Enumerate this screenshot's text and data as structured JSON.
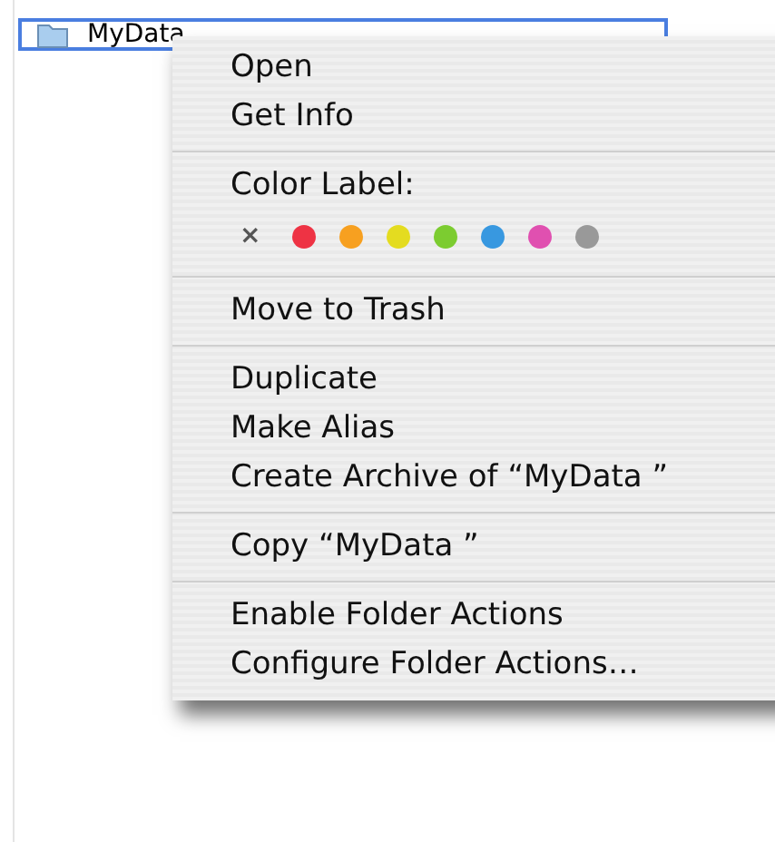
{
  "file_row": {
    "name": "MyData",
    "selected": true
  },
  "menu": [
    {
      "kind": "item",
      "label": "Open"
    },
    {
      "kind": "item",
      "label": "Get Info"
    },
    {
      "kind": "separator"
    },
    {
      "kind": "heading",
      "label": "Color Label:"
    },
    {
      "kind": "colors",
      "none": "×",
      "colors": [
        {
          "color": "#ee3344"
        },
        {
          "color": "#f7a020"
        },
        {
          "color": "#e4dc20"
        },
        {
          "color": "#7ccc30"
        },
        {
          "color": "#3898e0"
        },
        {
          "color": "#e050b0"
        },
        {
          "color": "#999999"
        }
      ]
    },
    {
      "kind": "separator"
    },
    {
      "kind": "item",
      "label": "Move to Trash"
    },
    {
      "kind": "separator"
    },
    {
      "kind": "item",
      "label": "Duplicate"
    },
    {
      "kind": "item",
      "label": "Make Alias"
    },
    {
      "kind": "item",
      "label": "Create Archive of “MyData ”"
    },
    {
      "kind": "separator"
    },
    {
      "kind": "item",
      "label": "Copy “MyData ”"
    },
    {
      "kind": "separator"
    },
    {
      "kind": "item",
      "label": "Enable Folder Actions"
    },
    {
      "kind": "item",
      "label": "Configure Folder Actions…"
    }
  ]
}
